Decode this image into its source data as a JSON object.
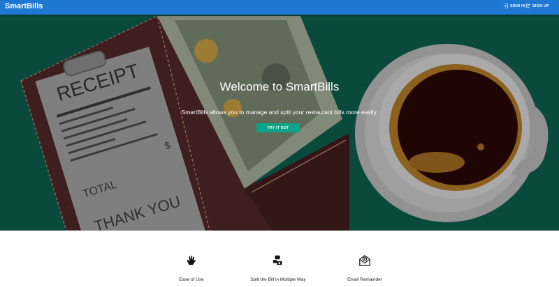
{
  "app": {
    "title": "SmartBills"
  },
  "nav": {
    "signin_label": "SIGN IN",
    "signup_label": "SIGN UP"
  },
  "hero": {
    "title": "Welcome to SmartBills",
    "subtitle": "SmartBills allows you to manage and split your restaurant bills more easily.",
    "cta_label": "TRY IT OUT"
  },
  "receipt": {
    "header": "RECEIPT",
    "total": "TOTAL",
    "thanks": "THANK YOU",
    "currency": "$"
  },
  "features": [
    {
      "label": "Ease of Use",
      "icon": "hand-wave-icon"
    },
    {
      "label": "Split the Bill in Multiple Way",
      "icon": "split-bill-icon"
    },
    {
      "label": "Email Remainder",
      "icon": "email-at-icon"
    }
  ],
  "colors": {
    "topbar": "#1e78d1",
    "hero_bg": "#0f5e4c",
    "cta": "#0aa589"
  }
}
